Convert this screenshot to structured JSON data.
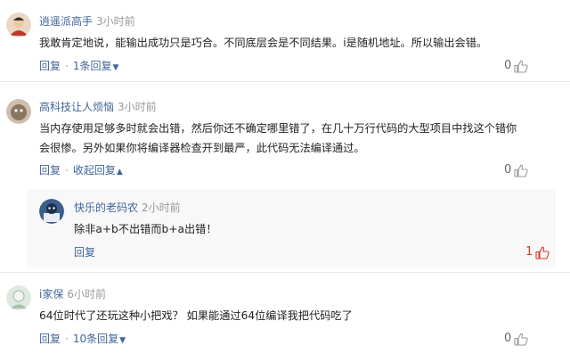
{
  "comments": [
    {
      "username": "逍遥派高手",
      "time": "3小时前",
      "text": "我敢肯定地说，能输出成功只是巧合。不同底层会是不同结果。i是随机地址。所以输出会错。",
      "reply_label": "回复",
      "replies_label": "1条回复",
      "likes": "0"
    },
    {
      "username": "高科技让人烦恼",
      "time": "3小时前",
      "text_line1": "当内存使用足够多时就会出错，然后你还不确定哪里错了，在几十万行代码的大型项目中找这个错你",
      "text_line2": "会很惨。另外如果你将编译器检查开到最严，此代码无法编译通过。",
      "reply_label": "回复",
      "collapse_label": "收起回复",
      "likes": "0",
      "sub_reply": {
        "username": "快乐的老码农",
        "time": "2小时前",
        "text": "除非a+b不出错而b+a出错！",
        "reply_label": "回复",
        "likes": "1"
      }
    },
    {
      "username": "i家保",
      "time": "6小时前",
      "text": "64位时代了还玩这种小把戏？ 如果能通过64位编译我把代码吃了",
      "reply_label": "回复",
      "replies_label": "10条回复",
      "likes": "0"
    }
  ],
  "colors": {
    "link": "#406599",
    "text": "#222222",
    "muted": "#999999",
    "like_active": "#d63a2b",
    "divider": "#e8e8e8"
  }
}
